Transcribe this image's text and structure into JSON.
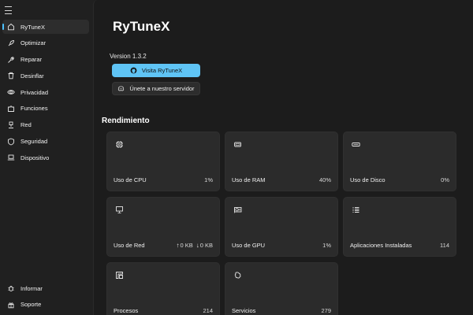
{
  "sidebar": {
    "items": [
      {
        "label": "RyTuneX",
        "icon": "home-icon"
      },
      {
        "label": "Optimizar",
        "icon": "rocket-icon"
      },
      {
        "label": "Reparar",
        "icon": "wrench-icon"
      },
      {
        "label": "Desinflar",
        "icon": "trash-icon"
      },
      {
        "label": "Privacidad",
        "icon": "eye-icon"
      },
      {
        "label": "Funciones",
        "icon": "puzzle-icon"
      },
      {
        "label": "Red",
        "icon": "network-icon"
      },
      {
        "label": "Seguridad",
        "icon": "shield-icon"
      },
      {
        "label": "Dispositivo",
        "icon": "laptop-icon"
      }
    ],
    "bottom": [
      {
        "label": "Informar",
        "icon": "bug-icon"
      },
      {
        "label": "Soporte",
        "icon": "support-icon"
      }
    ]
  },
  "main": {
    "title": "RyTuneX",
    "version": "Version 1.3.2",
    "visit_button": "Visita RyTuneX",
    "discord_button": "Únete a nuestro servidor",
    "section_title": "Rendimiento"
  },
  "cards": {
    "cpu": {
      "label": "Uso de CPU",
      "value": "1%",
      "icon": "cpu-icon"
    },
    "ram": {
      "label": "Uso de RAM",
      "value": "40%",
      "icon": "ram-icon"
    },
    "disk": {
      "label": "Uso de Disco",
      "value": "0%",
      "icon": "disk-icon"
    },
    "network": {
      "label": "Uso de Red",
      "up": "0 KB",
      "down": "0 KB",
      "icon": "monitor-network-icon"
    },
    "gpu": {
      "label": "Uso de GPU",
      "value": "1%",
      "icon": "gpu-icon"
    },
    "apps": {
      "label": "Aplicaciones Instaladas",
      "value": "114",
      "icon": "list-icon"
    },
    "processes": {
      "label": "Procesos",
      "value": "214",
      "icon": "processes-icon"
    },
    "services": {
      "label": "Servicios",
      "value": "279",
      "icon": "services-icon"
    }
  },
  "colors": {
    "accent": "#5fc4f5",
    "background": "#1c1c1c",
    "card": "#2b2b2b"
  }
}
